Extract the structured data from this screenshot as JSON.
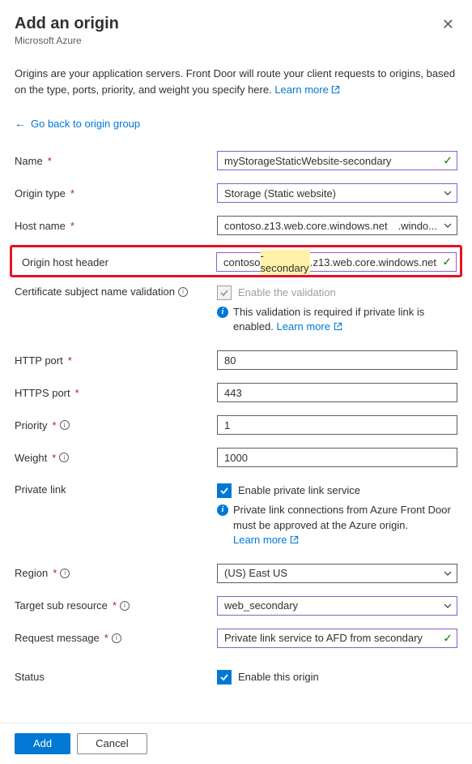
{
  "header": {
    "title": "Add an origin",
    "subtitle": "Microsoft Azure"
  },
  "description": "Origins are your application servers. Front Door will route your client requests to origins, based on the type, ports, priority, and weight you specify here. ",
  "learn_more": "Learn more",
  "back_link": "Go back to origin group",
  "fields": {
    "name": {
      "label": "Name",
      "value": "myStorageStaticWebsite-secondary"
    },
    "origin_type": {
      "label": "Origin type",
      "value": "Storage (Static website)"
    },
    "host_name": {
      "label": "Host name",
      "value": "contoso.z13.web.core.windows.net",
      "suffix": ".windo..."
    },
    "host_header": {
      "label": "Origin host header",
      "prefix": "contoso",
      "hl": "-secondary",
      "suffix": ".z13.web.core.windows.net"
    },
    "cert": {
      "label": "Certificate subject name validation",
      "cb_label": "Enable the validation",
      "msg": "This validation is required if private link is enabled. "
    },
    "http_port": {
      "label": "HTTP port",
      "value": "80"
    },
    "https_port": {
      "label": "HTTPS port",
      "value": "443"
    },
    "priority": {
      "label": "Priority",
      "value": "1"
    },
    "weight": {
      "label": "Weight",
      "value": "1000"
    },
    "private_link": {
      "label": "Private link",
      "cb_label": "Enable private link service",
      "msg": "Private link connections from Azure Front Door must be approved at the Azure origin."
    },
    "region": {
      "label": "Region",
      "value": "(US) East US"
    },
    "target": {
      "label": "Target sub resource",
      "value": "web_secondary"
    },
    "request_msg": {
      "label": "Request message",
      "value": "Private link service to AFD from secondary"
    },
    "status": {
      "label": "Status",
      "cb_label": "Enable this origin"
    }
  },
  "footer": {
    "add": "Add",
    "cancel": "Cancel"
  }
}
